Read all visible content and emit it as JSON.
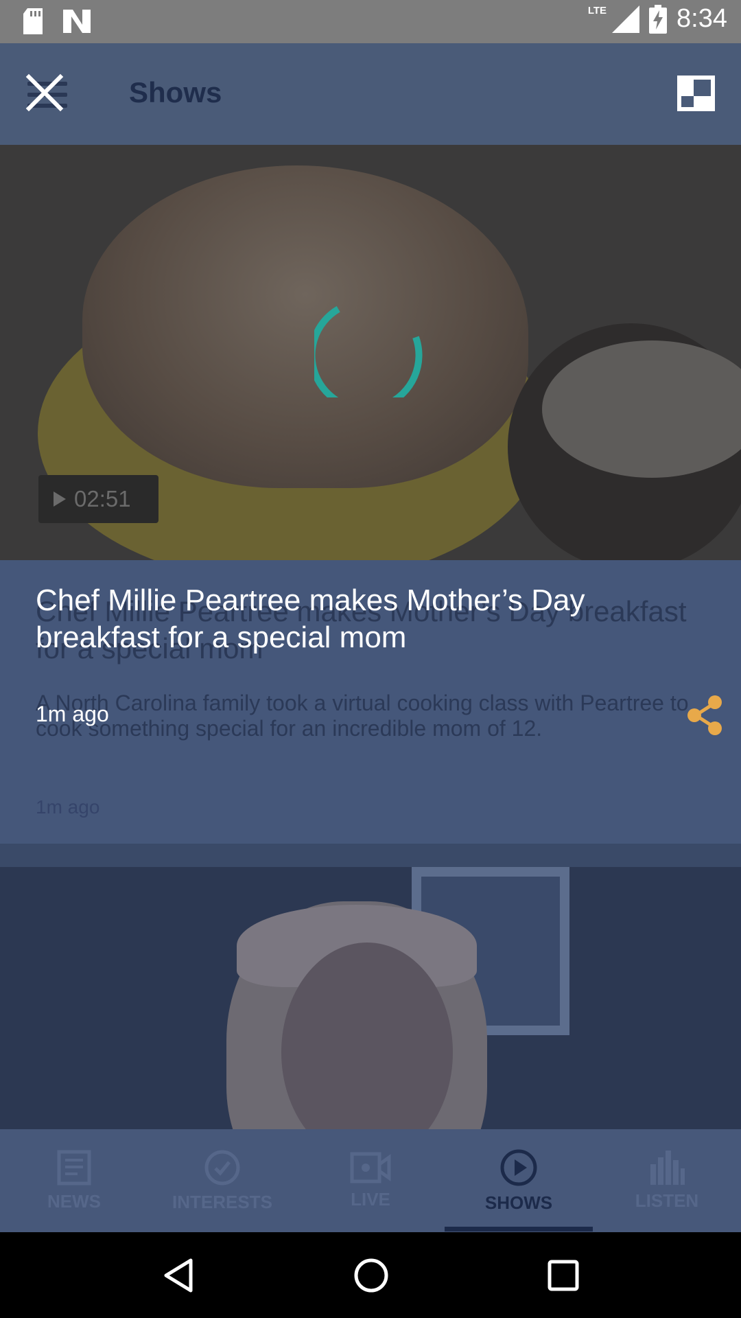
{
  "status_bar": {
    "time": "8:34",
    "network": "LTE",
    "icons": [
      "sd-card-icon",
      "n-logo-icon",
      "signal-icon",
      "battery-charging-icon"
    ]
  },
  "app_bar": {
    "title": "Shows"
  },
  "video": {
    "duration": "02:51",
    "loading": true,
    "spinner_color": "#26a69a"
  },
  "article": {
    "title": "Chef Millie Peartree makes Mother’s Day breakfast for a special mom",
    "description": "A North Carolina family took a virtual cooking class with Peartree to cook something special for an incredible mom of 12.",
    "time": "1m ago"
  },
  "overlay": {
    "title": "Chef Millie Peartree makes Mother’s Day breakfast for a special mom",
    "time": "1m ago",
    "share_color": "#e8a94a"
  },
  "tabs": [
    {
      "label": "NEWS",
      "icon": "news-icon",
      "active": false
    },
    {
      "label": "INTERESTS",
      "icon": "check-circle-icon",
      "active": false
    },
    {
      "label": "LIVE",
      "icon": "video-camera-icon",
      "active": false
    },
    {
      "label": "SHOWS",
      "icon": "play-circle-icon",
      "active": true
    },
    {
      "label": "LISTEN",
      "icon": "equalizer-icon",
      "active": false
    }
  ],
  "nav": {
    "buttons": [
      "back-icon",
      "home-icon",
      "recents-icon"
    ]
  }
}
